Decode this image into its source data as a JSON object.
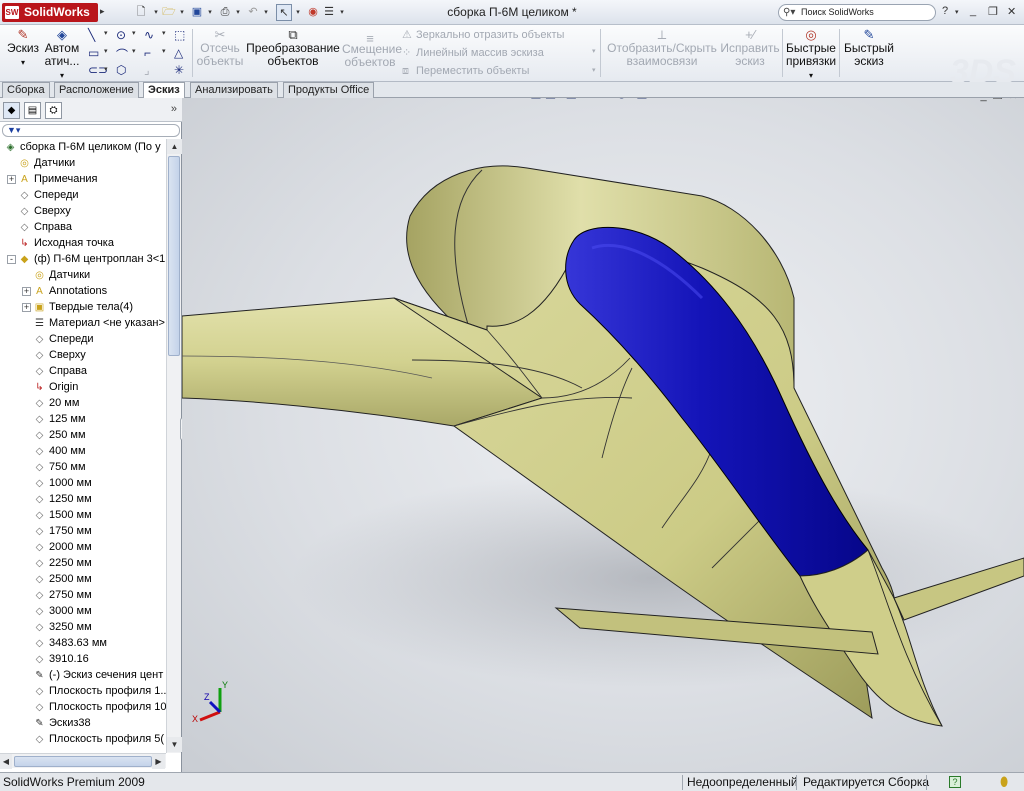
{
  "window": {
    "app_logo": "SolidWorks",
    "doc_title": "сборка П-6М целиком *",
    "search_placeholder": "Поиск SolidWorks",
    "help": "?",
    "minimize": "_",
    "restore": "❐",
    "close": "✕"
  },
  "commands": {
    "sketch": {
      "line1": "Эскиз",
      "line2": ""
    },
    "autodim": {
      "line1": "Автом",
      "line2": "атич..."
    },
    "trim": {
      "line1": "Отсечь",
      "line2": "объекты"
    },
    "convert": {
      "line1": "Преобразование",
      "line2": "объектов"
    },
    "offset": {
      "line1": "Смещение",
      "line2": "объектов"
    },
    "mirror": "Зеркально отразить объекты",
    "linear_pattern": "Линейный массив эскиза",
    "move": "Переместить объекты",
    "show_hide_rel": {
      "line1": "Отобразить/Скрыть",
      "line2": "взаимосвязи"
    },
    "repair": {
      "line1": "Исправить",
      "line2": "эскиз"
    },
    "quick_snaps": {
      "line1": "Быстрые",
      "line2": "привязки"
    },
    "rapid_sketch": {
      "line1": "Быстрый",
      "line2": "эскиз"
    }
  },
  "tabs": [
    "Сборка",
    "Расположение",
    "Эскиз",
    "Анализировать",
    "Продукты Office"
  ],
  "active_tab": "Эскиз",
  "tree": [
    {
      "label": "сборка П-6М целиком  (По у",
      "icon": "assembly-icon",
      "exp": "",
      "indent": 0
    },
    {
      "label": "Датчики",
      "icon": "sensors-icon",
      "exp": "",
      "indent": 1
    },
    {
      "label": "Примечания",
      "icon": "annotations-icon",
      "exp": "+",
      "indent": 1
    },
    {
      "label": "Спереди",
      "icon": "plane-icon",
      "exp": "",
      "indent": 1
    },
    {
      "label": "Сверху",
      "icon": "plane-icon",
      "exp": "",
      "indent": 1
    },
    {
      "label": "Справа",
      "icon": "plane-icon",
      "exp": "",
      "indent": 1
    },
    {
      "label": "Исходная точка",
      "icon": "origin-icon",
      "exp": "",
      "indent": 1
    },
    {
      "label": "(ф) П-6М центроплан 3<1",
      "icon": "part-icon",
      "exp": "-",
      "indent": 1
    },
    {
      "label": "Датчики",
      "icon": "sensors-icon",
      "exp": "",
      "indent": 2
    },
    {
      "label": "Annotations",
      "icon": "annotations-icon",
      "exp": "+",
      "indent": 2
    },
    {
      "label": "Твердые тела(4)",
      "icon": "solid-bodies-icon",
      "exp": "+",
      "indent": 2
    },
    {
      "label": "Материал <не указан>",
      "icon": "material-icon",
      "exp": "",
      "indent": 2
    },
    {
      "label": "Спереди",
      "icon": "plane-icon",
      "exp": "",
      "indent": 2
    },
    {
      "label": "Сверху",
      "icon": "plane-icon",
      "exp": "",
      "indent": 2
    },
    {
      "label": "Справа",
      "icon": "plane-icon",
      "exp": "",
      "indent": 2
    },
    {
      "label": "Origin",
      "icon": "origin-icon",
      "exp": "",
      "indent": 2
    },
    {
      "label": "20 мм",
      "icon": "plane-icon",
      "exp": "",
      "indent": 2
    },
    {
      "label": "125 мм",
      "icon": "plane-icon",
      "exp": "",
      "indent": 2
    },
    {
      "label": "250 мм",
      "icon": "plane-icon",
      "exp": "",
      "indent": 2
    },
    {
      "label": "400 мм",
      "icon": "plane-icon",
      "exp": "",
      "indent": 2
    },
    {
      "label": "750 мм",
      "icon": "plane-icon",
      "exp": "",
      "indent": 2
    },
    {
      "label": "1000 мм",
      "icon": "plane-icon",
      "exp": "",
      "indent": 2
    },
    {
      "label": "1250 мм",
      "icon": "plane-icon",
      "exp": "",
      "indent": 2
    },
    {
      "label": "1500 мм",
      "icon": "plane-icon",
      "exp": "",
      "indent": 2
    },
    {
      "label": "1750 мм",
      "icon": "plane-icon",
      "exp": "",
      "indent": 2
    },
    {
      "label": "2000 мм",
      "icon": "plane-icon",
      "exp": "",
      "indent": 2
    },
    {
      "label": "2250 мм",
      "icon": "plane-icon",
      "exp": "",
      "indent": 2
    },
    {
      "label": "2500 мм",
      "icon": "plane-icon",
      "exp": "",
      "indent": 2
    },
    {
      "label": "2750 мм",
      "icon": "plane-icon",
      "exp": "",
      "indent": 2
    },
    {
      "label": "3000 мм",
      "icon": "plane-icon",
      "exp": "",
      "indent": 2
    },
    {
      "label": "3250 мм",
      "icon": "plane-icon",
      "exp": "",
      "indent": 2
    },
    {
      "label": "3483.63 мм",
      "icon": "plane-icon",
      "exp": "",
      "indent": 2
    },
    {
      "label": "3910.16",
      "icon": "plane-icon",
      "exp": "",
      "indent": 2
    },
    {
      "label": "(-) Эскиз сечения  цент",
      "icon": "sketch-icon",
      "exp": "",
      "indent": 2
    },
    {
      "label": "Плоскость профиля 1...",
      "icon": "plane-icon",
      "exp": "",
      "indent": 2
    },
    {
      "label": "Плоскость профиля 10",
      "icon": "plane-icon",
      "exp": "",
      "indent": 2
    },
    {
      "label": "Эскиз38",
      "icon": "sketch-icon",
      "exp": "",
      "indent": 2
    },
    {
      "label": "Плоскость профиля 5(",
      "icon": "plane-icon",
      "exp": "",
      "indent": 2
    }
  ],
  "status": {
    "app": "SolidWorks Premium 2009",
    "state": "Недоопределенный",
    "mode": "Редактируется Сборка",
    "help_icon": "?"
  },
  "triad": {
    "x": "X",
    "y": "Y",
    "z": "Z"
  },
  "colors": {
    "body": "#cccb86",
    "canopy": "#1010b4",
    "accent": "#b9151b"
  }
}
